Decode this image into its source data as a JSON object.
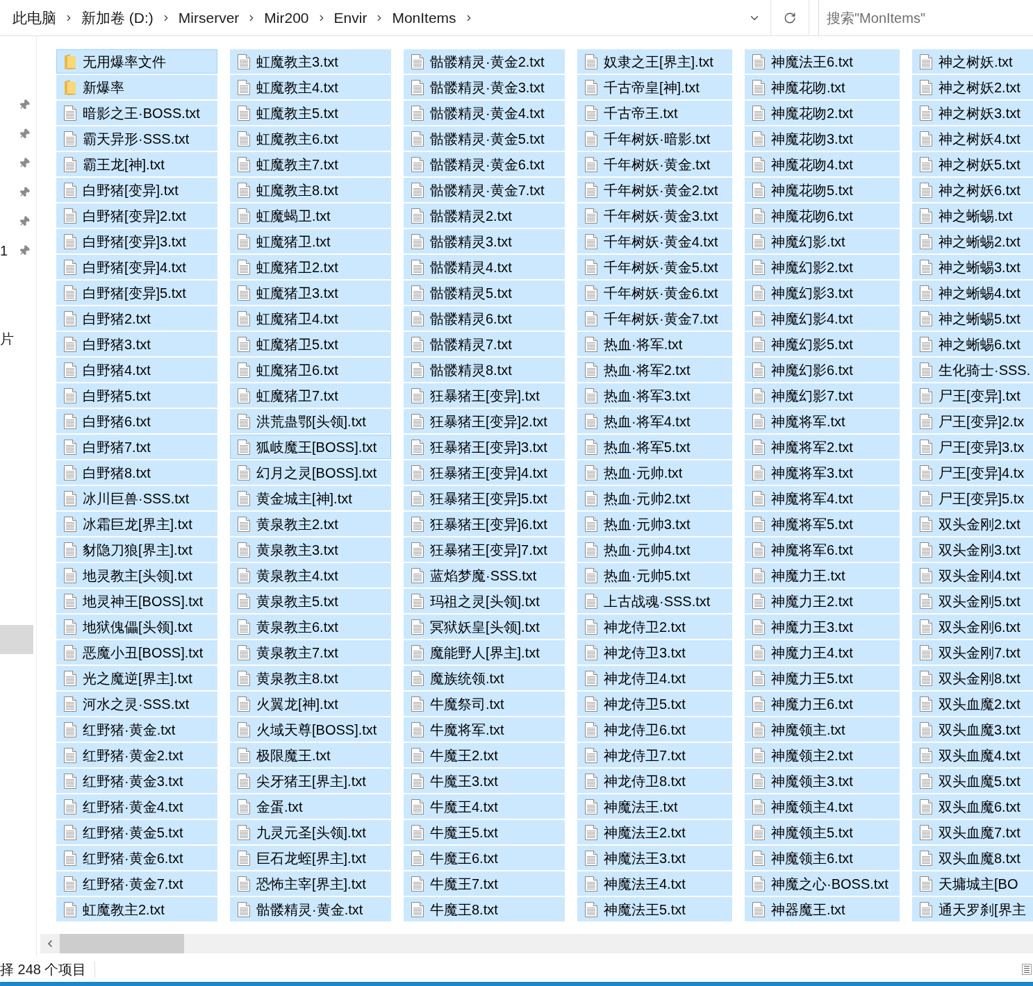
{
  "address_bar": {
    "breadcrumbs": [
      "此电脑",
      "新加卷 (D:)",
      "Mirserver",
      "Mir200",
      "Envir",
      "MonItems"
    ]
  },
  "search": {
    "placeholder": "搜索\"MonItems\""
  },
  "nav_pane": {
    "items": [
      {
        "pinned": true,
        "selected": false
      },
      {
        "pinned": true,
        "selected": false
      },
      {
        "pinned": true,
        "selected": false
      },
      {
        "pinned": true,
        "selected": false
      },
      {
        "pinned": true,
        "selected": false
      },
      {
        "label": "1",
        "pinned": true,
        "selected": false
      },
      {
        "label": "片",
        "pinned": false,
        "selected": false
      },
      {
        "pinned": false,
        "selected": true
      }
    ]
  },
  "columns": [
    [
      {
        "name": "无用爆率文件",
        "kind": "folder",
        "selected": true,
        "focused": true
      },
      {
        "name": "新爆率",
        "kind": "folder",
        "selected": true,
        "focused": false
      },
      {
        "name": "暗影之王·BOSS.txt",
        "kind": "file",
        "selected": true,
        "focused": false
      },
      {
        "name": "霸天异形·SSS.txt",
        "kind": "file",
        "selected": true,
        "focused": false
      },
      {
        "name": "霸王龙[神].txt",
        "kind": "file",
        "selected": true,
        "focused": false
      },
      {
        "name": "白野猪[变异].txt",
        "kind": "file",
        "selected": true,
        "focused": false
      },
      {
        "name": "白野猪[变异]2.txt",
        "kind": "file",
        "selected": true,
        "focused": false
      },
      {
        "name": "白野猪[变异]3.txt",
        "kind": "file",
        "selected": true,
        "focused": false
      },
      {
        "name": "白野猪[变异]4.txt",
        "kind": "file",
        "selected": true,
        "focused": false
      },
      {
        "name": "白野猪[变异]5.txt",
        "kind": "file",
        "selected": true,
        "focused": false
      },
      {
        "name": "白野猪2.txt",
        "kind": "file",
        "selected": true,
        "focused": false
      },
      {
        "name": "白野猪3.txt",
        "kind": "file",
        "selected": true,
        "focused": false
      },
      {
        "name": "白野猪4.txt",
        "kind": "file",
        "selected": true,
        "focused": false
      },
      {
        "name": "白野猪5.txt",
        "kind": "file",
        "selected": true,
        "focused": false
      },
      {
        "name": "白野猪6.txt",
        "kind": "file",
        "selected": true,
        "focused": false
      },
      {
        "name": "白野猪7.txt",
        "kind": "file",
        "selected": true,
        "focused": false
      },
      {
        "name": "白野猪8.txt",
        "kind": "file",
        "selected": true,
        "focused": false
      },
      {
        "name": "冰川巨兽·SSS.txt",
        "kind": "file",
        "selected": true,
        "focused": false
      },
      {
        "name": "冰霜巨龙[界主].txt",
        "kind": "file",
        "selected": true,
        "focused": false
      },
      {
        "name": "豺隐刀狼[界主].txt",
        "kind": "file",
        "selected": true,
        "focused": false
      },
      {
        "name": "地灵教主[头领].txt",
        "kind": "file",
        "selected": true,
        "focused": false
      },
      {
        "name": "地灵神王[BOSS].txt",
        "kind": "file",
        "selected": true,
        "focused": false
      },
      {
        "name": "地狱傀儡[头领].txt",
        "kind": "file",
        "selected": true,
        "focused": false
      },
      {
        "name": "恶魔小丑[BOSS].txt",
        "kind": "file",
        "selected": true,
        "focused": false
      },
      {
        "name": "光之魔逆[界主].txt",
        "kind": "file",
        "selected": true,
        "focused": false
      },
      {
        "name": "河水之灵·SSS.txt",
        "kind": "file",
        "selected": true,
        "focused": false
      },
      {
        "name": "红野猪·黄金.txt",
        "kind": "file",
        "selected": true,
        "focused": false
      },
      {
        "name": "红野猪·黄金2.txt",
        "kind": "file",
        "selected": true,
        "focused": false
      },
      {
        "name": "红野猪·黄金3.txt",
        "kind": "file",
        "selected": true,
        "focused": false
      },
      {
        "name": "红野猪·黄金4.txt",
        "kind": "file",
        "selected": true,
        "focused": false
      },
      {
        "name": "红野猪·黄金5.txt",
        "kind": "file",
        "selected": true,
        "focused": false
      },
      {
        "name": "红野猪·黄金6.txt",
        "kind": "file",
        "selected": true,
        "focused": false
      },
      {
        "name": "红野猪·黄金7.txt",
        "kind": "file",
        "selected": true,
        "focused": false
      },
      {
        "name": "虹魔教主2.txt",
        "kind": "file",
        "selected": true,
        "focused": false
      }
    ],
    [
      {
        "name": "虹魔教主3.txt",
        "kind": "file",
        "selected": true,
        "focused": false
      },
      {
        "name": "虹魔教主4.txt",
        "kind": "file",
        "selected": true,
        "focused": false
      },
      {
        "name": "虹魔教主5.txt",
        "kind": "file",
        "selected": true,
        "focused": false
      },
      {
        "name": "虹魔教主6.txt",
        "kind": "file",
        "selected": true,
        "focused": false
      },
      {
        "name": "虹魔教主7.txt",
        "kind": "file",
        "selected": true,
        "focused": false
      },
      {
        "name": "虹魔教主8.txt",
        "kind": "file",
        "selected": true,
        "focused": false
      },
      {
        "name": "虹魔蝎卫.txt",
        "kind": "file",
        "selected": true,
        "focused": false
      },
      {
        "name": "虹魔猪卫.txt",
        "kind": "file",
        "selected": true,
        "focused": false
      },
      {
        "name": "虹魔猪卫2.txt",
        "kind": "file",
        "selected": true,
        "focused": false
      },
      {
        "name": "虹魔猪卫3.txt",
        "kind": "file",
        "selected": true,
        "focused": false
      },
      {
        "name": "虹魔猪卫4.txt",
        "kind": "file",
        "selected": true,
        "focused": false
      },
      {
        "name": "虹魔猪卫5.txt",
        "kind": "file",
        "selected": true,
        "focused": false
      },
      {
        "name": "虹魔猪卫6.txt",
        "kind": "file",
        "selected": true,
        "focused": false
      },
      {
        "name": "虹魔猪卫7.txt",
        "kind": "file",
        "selected": true,
        "focused": false
      },
      {
        "name": "洪荒蛊鄂[头领].txt",
        "kind": "file",
        "selected": true,
        "focused": false
      },
      {
        "name": "狐岐魔王[BOSS].txt",
        "kind": "file",
        "selected": true,
        "focused": true
      },
      {
        "name": "幻月之灵[BOSS].txt",
        "kind": "file",
        "selected": true,
        "focused": false
      },
      {
        "name": "黄金城主[神].txt",
        "kind": "file",
        "selected": true,
        "focused": false
      },
      {
        "name": "黄泉教主2.txt",
        "kind": "file",
        "selected": true,
        "focused": false
      },
      {
        "name": "黄泉教主3.txt",
        "kind": "file",
        "selected": true,
        "focused": false
      },
      {
        "name": "黄泉教主4.txt",
        "kind": "file",
        "selected": true,
        "focused": false
      },
      {
        "name": "黄泉教主5.txt",
        "kind": "file",
        "selected": true,
        "focused": false
      },
      {
        "name": "黄泉教主6.txt",
        "kind": "file",
        "selected": true,
        "focused": false
      },
      {
        "name": "黄泉教主7.txt",
        "kind": "file",
        "selected": true,
        "focused": false
      },
      {
        "name": "黄泉教主8.txt",
        "kind": "file",
        "selected": true,
        "focused": false
      },
      {
        "name": "火翼龙[神].txt",
        "kind": "file",
        "selected": true,
        "focused": false
      },
      {
        "name": "火域天尊[BOSS].txt",
        "kind": "file",
        "selected": true,
        "focused": false
      },
      {
        "name": "极限魔王.txt",
        "kind": "file",
        "selected": true,
        "focused": false
      },
      {
        "name": "尖牙猪王[界主].txt",
        "kind": "file",
        "selected": true,
        "focused": false
      },
      {
        "name": "金蛋.txt",
        "kind": "file",
        "selected": true,
        "focused": false
      },
      {
        "name": "九灵元圣[头领].txt",
        "kind": "file",
        "selected": true,
        "focused": false
      },
      {
        "name": "巨石龙蛭[界主].txt",
        "kind": "file",
        "selected": true,
        "focused": false
      },
      {
        "name": "恐怖主宰[界主].txt",
        "kind": "file",
        "selected": true,
        "focused": false
      },
      {
        "name": "骷髅精灵·黄金.txt",
        "kind": "file",
        "selected": true,
        "focused": false
      }
    ],
    [
      {
        "name": "骷髅精灵·黄金2.txt",
        "kind": "file",
        "selected": true,
        "focused": false
      },
      {
        "name": "骷髅精灵·黄金3.txt",
        "kind": "file",
        "selected": true,
        "focused": false
      },
      {
        "name": "骷髅精灵·黄金4.txt",
        "kind": "file",
        "selected": true,
        "focused": false
      },
      {
        "name": "骷髅精灵·黄金5.txt",
        "kind": "file",
        "selected": true,
        "focused": false
      },
      {
        "name": "骷髅精灵·黄金6.txt",
        "kind": "file",
        "selected": true,
        "focused": false
      },
      {
        "name": "骷髅精灵·黄金7.txt",
        "kind": "file",
        "selected": true,
        "focused": false
      },
      {
        "name": "骷髅精灵2.txt",
        "kind": "file",
        "selected": true,
        "focused": false
      },
      {
        "name": "骷髅精灵3.txt",
        "kind": "file",
        "selected": true,
        "focused": false
      },
      {
        "name": "骷髅精灵4.txt",
        "kind": "file",
        "selected": true,
        "focused": false
      },
      {
        "name": "骷髅精灵5.txt",
        "kind": "file",
        "selected": true,
        "focused": false
      },
      {
        "name": "骷髅精灵6.txt",
        "kind": "file",
        "selected": true,
        "focused": false
      },
      {
        "name": "骷髅精灵7.txt",
        "kind": "file",
        "selected": true,
        "focused": false
      },
      {
        "name": "骷髅精灵8.txt",
        "kind": "file",
        "selected": true,
        "focused": false
      },
      {
        "name": "狂暴猪王[变异].txt",
        "kind": "file",
        "selected": true,
        "focused": false
      },
      {
        "name": "狂暴猪王[变异]2.txt",
        "kind": "file",
        "selected": true,
        "focused": false
      },
      {
        "name": "狂暴猪王[变异]3.txt",
        "kind": "file",
        "selected": true,
        "focused": false
      },
      {
        "name": "狂暴猪王[变异]4.txt",
        "kind": "file",
        "selected": true,
        "focused": false
      },
      {
        "name": "狂暴猪王[变异]5.txt",
        "kind": "file",
        "selected": true,
        "focused": false
      },
      {
        "name": "狂暴猪王[变异]6.txt",
        "kind": "file",
        "selected": true,
        "focused": false
      },
      {
        "name": "狂暴猪王[变异]7.txt",
        "kind": "file",
        "selected": true,
        "focused": false
      },
      {
        "name": "蓝焰梦魔·SSS.txt",
        "kind": "file",
        "selected": true,
        "focused": false
      },
      {
        "name": "玛祖之灵[头领].txt",
        "kind": "file",
        "selected": true,
        "focused": false
      },
      {
        "name": "冥狱妖皇[头领].txt",
        "kind": "file",
        "selected": true,
        "focused": false
      },
      {
        "name": "魔能野人[界主].txt",
        "kind": "file",
        "selected": true,
        "focused": false
      },
      {
        "name": "魔族统领.txt",
        "kind": "file",
        "selected": true,
        "focused": false
      },
      {
        "name": "牛魔祭司.txt",
        "kind": "file",
        "selected": true,
        "focused": false
      },
      {
        "name": "牛魔将军.txt",
        "kind": "file",
        "selected": true,
        "focused": false
      },
      {
        "name": "牛魔王2.txt",
        "kind": "file",
        "selected": true,
        "focused": false
      },
      {
        "name": "牛魔王3.txt",
        "kind": "file",
        "selected": true,
        "focused": false
      },
      {
        "name": "牛魔王4.txt",
        "kind": "file",
        "selected": true,
        "focused": false
      },
      {
        "name": "牛魔王5.txt",
        "kind": "file",
        "selected": true,
        "focused": false
      },
      {
        "name": "牛魔王6.txt",
        "kind": "file",
        "selected": true,
        "focused": false
      },
      {
        "name": "牛魔王7.txt",
        "kind": "file",
        "selected": true,
        "focused": false
      },
      {
        "name": "牛魔王8.txt",
        "kind": "file",
        "selected": true,
        "focused": false
      }
    ],
    [
      {
        "name": "奴隶之王[界主].txt",
        "kind": "file",
        "selected": true,
        "focused": false
      },
      {
        "name": "千古帝皇[神].txt",
        "kind": "file",
        "selected": true,
        "focused": false
      },
      {
        "name": "千古帝王.txt",
        "kind": "file",
        "selected": true,
        "focused": false
      },
      {
        "name": "千年树妖·暗影.txt",
        "kind": "file",
        "selected": true,
        "focused": false
      },
      {
        "name": "千年树妖·黄金.txt",
        "kind": "file",
        "selected": true,
        "focused": false
      },
      {
        "name": "千年树妖·黄金2.txt",
        "kind": "file",
        "selected": true,
        "focused": false
      },
      {
        "name": "千年树妖·黄金3.txt",
        "kind": "file",
        "selected": true,
        "focused": false
      },
      {
        "name": "千年树妖·黄金4.txt",
        "kind": "file",
        "selected": true,
        "focused": false
      },
      {
        "name": "千年树妖·黄金5.txt",
        "kind": "file",
        "selected": true,
        "focused": false
      },
      {
        "name": "千年树妖·黄金6.txt",
        "kind": "file",
        "selected": true,
        "focused": false
      },
      {
        "name": "千年树妖·黄金7.txt",
        "kind": "file",
        "selected": true,
        "focused": false
      },
      {
        "name": "热血·将军.txt",
        "kind": "file",
        "selected": true,
        "focused": false
      },
      {
        "name": "热血·将军2.txt",
        "kind": "file",
        "selected": true,
        "focused": false
      },
      {
        "name": "热血·将军3.txt",
        "kind": "file",
        "selected": true,
        "focused": false
      },
      {
        "name": "热血·将军4.txt",
        "kind": "file",
        "selected": true,
        "focused": false
      },
      {
        "name": "热血·将军5.txt",
        "kind": "file",
        "selected": true,
        "focused": false
      },
      {
        "name": "热血·元帅.txt",
        "kind": "file",
        "selected": true,
        "focused": false
      },
      {
        "name": "热血·元帅2.txt",
        "kind": "file",
        "selected": true,
        "focused": false
      },
      {
        "name": "热血·元帅3.txt",
        "kind": "file",
        "selected": true,
        "focused": false
      },
      {
        "name": "热血·元帅4.txt",
        "kind": "file",
        "selected": true,
        "focused": false
      },
      {
        "name": "热血·元帅5.txt",
        "kind": "file",
        "selected": true,
        "focused": false
      },
      {
        "name": "上古战魂·SSS.txt",
        "kind": "file",
        "selected": true,
        "focused": false
      },
      {
        "name": "神龙侍卫2.txt",
        "kind": "file",
        "selected": true,
        "focused": false
      },
      {
        "name": "神龙侍卫3.txt",
        "kind": "file",
        "selected": true,
        "focused": false
      },
      {
        "name": "神龙侍卫4.txt",
        "kind": "file",
        "selected": true,
        "focused": false
      },
      {
        "name": "神龙侍卫5.txt",
        "kind": "file",
        "selected": true,
        "focused": false
      },
      {
        "name": "神龙侍卫6.txt",
        "kind": "file",
        "selected": true,
        "focused": false
      },
      {
        "name": "神龙侍卫7.txt",
        "kind": "file",
        "selected": true,
        "focused": false
      },
      {
        "name": "神龙侍卫8.txt",
        "kind": "file",
        "selected": true,
        "focused": false
      },
      {
        "name": "神魔法王.txt",
        "kind": "file",
        "selected": true,
        "focused": false
      },
      {
        "name": "神魔法王2.txt",
        "kind": "file",
        "selected": true,
        "focused": false
      },
      {
        "name": "神魔法王3.txt",
        "kind": "file",
        "selected": true,
        "focused": false
      },
      {
        "name": "神魔法王4.txt",
        "kind": "file",
        "selected": true,
        "focused": false
      },
      {
        "name": "神魔法王5.txt",
        "kind": "file",
        "selected": true,
        "focused": false
      }
    ],
    [
      {
        "name": "神魔法王6.txt",
        "kind": "file",
        "selected": true,
        "focused": false
      },
      {
        "name": "神魔花吻.txt",
        "kind": "file",
        "selected": true,
        "focused": false
      },
      {
        "name": "神魔花吻2.txt",
        "kind": "file",
        "selected": true,
        "focused": false
      },
      {
        "name": "神魔花吻3.txt",
        "kind": "file",
        "selected": true,
        "focused": false
      },
      {
        "name": "神魔花吻4.txt",
        "kind": "file",
        "selected": true,
        "focused": false
      },
      {
        "name": "神魔花吻5.txt",
        "kind": "file",
        "selected": true,
        "focused": false
      },
      {
        "name": "神魔花吻6.txt",
        "kind": "file",
        "selected": true,
        "focused": false
      },
      {
        "name": "神魔幻影.txt",
        "kind": "file",
        "selected": true,
        "focused": false
      },
      {
        "name": "神魔幻影2.txt",
        "kind": "file",
        "selected": true,
        "focused": false
      },
      {
        "name": "神魔幻影3.txt",
        "kind": "file",
        "selected": true,
        "focused": false
      },
      {
        "name": "神魔幻影4.txt",
        "kind": "file",
        "selected": true,
        "focused": false
      },
      {
        "name": "神魔幻影5.txt",
        "kind": "file",
        "selected": true,
        "focused": false
      },
      {
        "name": "神魔幻影6.txt",
        "kind": "file",
        "selected": true,
        "focused": false
      },
      {
        "name": "神魔幻影7.txt",
        "kind": "file",
        "selected": true,
        "focused": false
      },
      {
        "name": "神魔将军.txt",
        "kind": "file",
        "selected": true,
        "focused": false
      },
      {
        "name": "神魔将军2.txt",
        "kind": "file",
        "selected": true,
        "focused": false
      },
      {
        "name": "神魔将军3.txt",
        "kind": "file",
        "selected": true,
        "focused": false
      },
      {
        "name": "神魔将军4.txt",
        "kind": "file",
        "selected": true,
        "focused": false
      },
      {
        "name": "神魔将军5.txt",
        "kind": "file",
        "selected": true,
        "focused": false
      },
      {
        "name": "神魔将军6.txt",
        "kind": "file",
        "selected": true,
        "focused": false
      },
      {
        "name": "神魔力王.txt",
        "kind": "file",
        "selected": true,
        "focused": false
      },
      {
        "name": "神魔力王2.txt",
        "kind": "file",
        "selected": true,
        "focused": false
      },
      {
        "name": "神魔力王3.txt",
        "kind": "file",
        "selected": true,
        "focused": false
      },
      {
        "name": "神魔力王4.txt",
        "kind": "file",
        "selected": true,
        "focused": false
      },
      {
        "name": "神魔力王5.txt",
        "kind": "file",
        "selected": true,
        "focused": false
      },
      {
        "name": "神魔力王6.txt",
        "kind": "file",
        "selected": true,
        "focused": false
      },
      {
        "name": "神魔领主.txt",
        "kind": "file",
        "selected": true,
        "focused": false
      },
      {
        "name": "神魔领主2.txt",
        "kind": "file",
        "selected": true,
        "focused": false
      },
      {
        "name": "神魔领主3.txt",
        "kind": "file",
        "selected": true,
        "focused": false
      },
      {
        "name": "神魔领主4.txt",
        "kind": "file",
        "selected": true,
        "focused": false
      },
      {
        "name": "神魔领主5.txt",
        "kind": "file",
        "selected": true,
        "focused": false
      },
      {
        "name": "神魔领主6.txt",
        "kind": "file",
        "selected": true,
        "focused": false
      },
      {
        "name": "神魔之心·BOSS.txt",
        "kind": "file",
        "selected": true,
        "focused": false
      },
      {
        "name": "神器魔王.txt",
        "kind": "file",
        "selected": true,
        "focused": false
      }
    ],
    [
      {
        "name": "神之树妖.txt",
        "kind": "file",
        "selected": true,
        "focused": false
      },
      {
        "name": "神之树妖2.txt",
        "kind": "file",
        "selected": true,
        "focused": false
      },
      {
        "name": "神之树妖3.txt",
        "kind": "file",
        "selected": true,
        "focused": false
      },
      {
        "name": "神之树妖4.txt",
        "kind": "file",
        "selected": true,
        "focused": false
      },
      {
        "name": "神之树妖5.txt",
        "kind": "file",
        "selected": true,
        "focused": false
      },
      {
        "name": "神之树妖6.txt",
        "kind": "file",
        "selected": true,
        "focused": false
      },
      {
        "name": "神之蜥蜴.txt",
        "kind": "file",
        "selected": true,
        "focused": false
      },
      {
        "name": "神之蜥蜴2.txt",
        "kind": "file",
        "selected": true,
        "focused": false
      },
      {
        "name": "神之蜥蜴3.txt",
        "kind": "file",
        "selected": true,
        "focused": false
      },
      {
        "name": "神之蜥蜴4.txt",
        "kind": "file",
        "selected": true,
        "focused": false
      },
      {
        "name": "神之蜥蜴5.txt",
        "kind": "file",
        "selected": true,
        "focused": false
      },
      {
        "name": "神之蜥蜴6.txt",
        "kind": "file",
        "selected": true,
        "focused": false
      },
      {
        "name": "生化骑士·SSS.",
        "kind": "file",
        "selected": true,
        "focused": false
      },
      {
        "name": "尸王[变异].txt",
        "kind": "file",
        "selected": true,
        "focused": false
      },
      {
        "name": "尸王[变异]2.tx",
        "kind": "file",
        "selected": true,
        "focused": false
      },
      {
        "name": "尸王[变异]3.tx",
        "kind": "file",
        "selected": true,
        "focused": false
      },
      {
        "name": "尸王[变异]4.tx",
        "kind": "file",
        "selected": true,
        "focused": false
      },
      {
        "name": "尸王[变异]5.tx",
        "kind": "file",
        "selected": true,
        "focused": false
      },
      {
        "name": "双头金刚2.txt",
        "kind": "file",
        "selected": true,
        "focused": false
      },
      {
        "name": "双头金刚3.txt",
        "kind": "file",
        "selected": true,
        "focused": false
      },
      {
        "name": "双头金刚4.txt",
        "kind": "file",
        "selected": true,
        "focused": false
      },
      {
        "name": "双头金刚5.txt",
        "kind": "file",
        "selected": true,
        "focused": false
      },
      {
        "name": "双头金刚6.txt",
        "kind": "file",
        "selected": true,
        "focused": false
      },
      {
        "name": "双头金刚7.txt",
        "kind": "file",
        "selected": true,
        "focused": false
      },
      {
        "name": "双头金刚8.txt",
        "kind": "file",
        "selected": true,
        "focused": false
      },
      {
        "name": "双头血魔2.txt",
        "kind": "file",
        "selected": true,
        "focused": false
      },
      {
        "name": "双头血魔3.txt",
        "kind": "file",
        "selected": true,
        "focused": false
      },
      {
        "name": "双头血魔4.txt",
        "kind": "file",
        "selected": true,
        "focused": false
      },
      {
        "name": "双头血魔5.txt",
        "kind": "file",
        "selected": true,
        "focused": false
      },
      {
        "name": "双头血魔6.txt",
        "kind": "file",
        "selected": true,
        "focused": false
      },
      {
        "name": "双头血魔7.txt",
        "kind": "file",
        "selected": true,
        "focused": false
      },
      {
        "name": "双头血魔8.txt",
        "kind": "file",
        "selected": true,
        "focused": false
      },
      {
        "name": "天墉城主[BO",
        "kind": "file",
        "selected": true,
        "focused": false
      },
      {
        "name": "通天罗刹[界主",
        "kind": "file",
        "selected": true,
        "focused": false
      }
    ]
  ],
  "status_bar": {
    "text": "择 248 个项目"
  }
}
